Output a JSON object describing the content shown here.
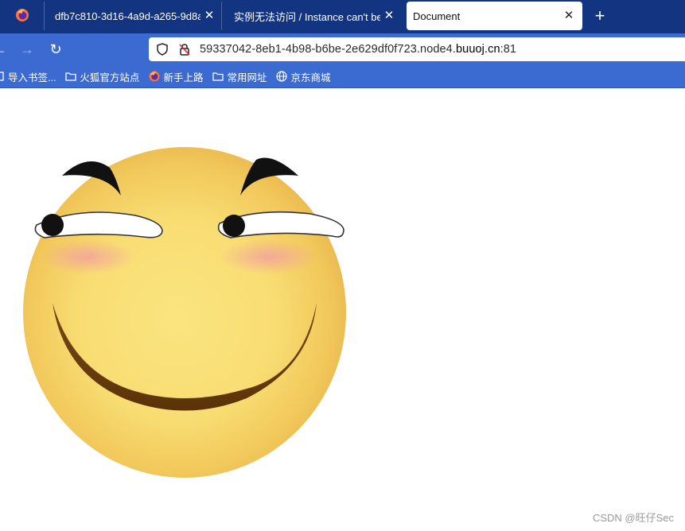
{
  "tabs": [
    {
      "title": "",
      "icon": "firefox-icon"
    },
    {
      "title": "dfb7c810-3d16-4a9d-a265-9d8a",
      "close": "✕"
    },
    {
      "title": "实例无法访问 / Instance can't be r",
      "close": "✕"
    },
    {
      "title": "Document",
      "close": "✕",
      "active": true
    }
  ],
  "new_tab_label": "+",
  "nav": {
    "back": "←",
    "forward": "→",
    "reload": "↻"
  },
  "url": {
    "prefix": "59337042-8eb1-4b98-b6be-2e629df0f723.node4.",
    "domain": "buuoj.cn",
    "suffix": ":81"
  },
  "bookmarks": [
    {
      "label": "导入书签...",
      "icon": "import-icon"
    },
    {
      "label": "火狐官方站点",
      "icon": "folder-icon"
    },
    {
      "label": "新手上路",
      "icon": "firefox-icon"
    },
    {
      "label": "常用网址",
      "icon": "folder-icon"
    },
    {
      "label": "京东商城",
      "icon": "globe-icon"
    }
  ],
  "watermark": "CSDN @旺仔Sec",
  "colors": {
    "tabbar": "#123481",
    "toolbar": "#3b6bd0",
    "face": "#f7d86a"
  }
}
